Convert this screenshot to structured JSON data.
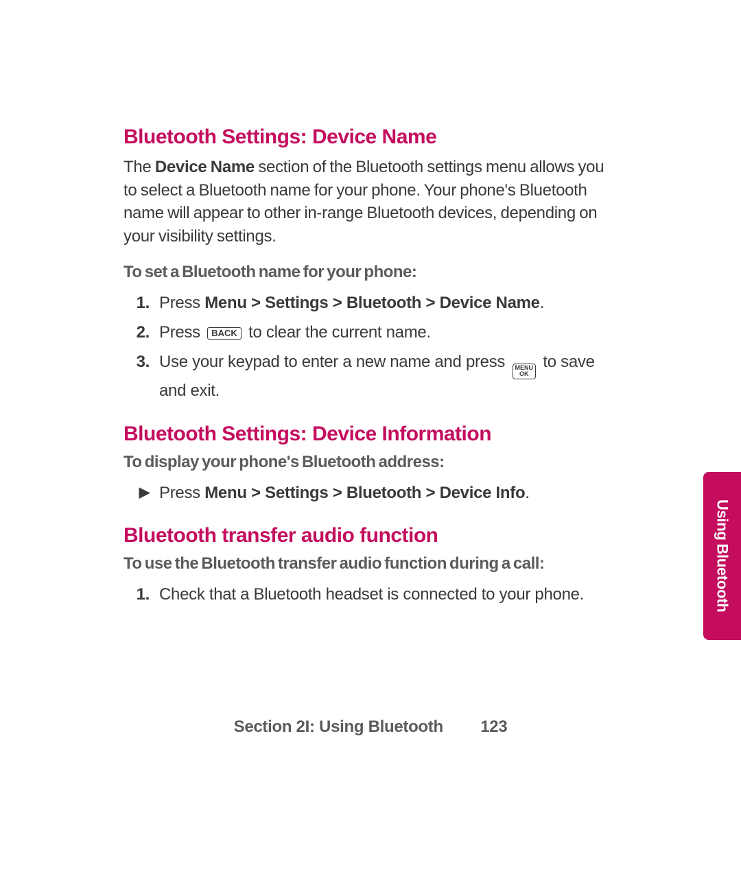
{
  "section1": {
    "heading": "Bluetooth Settings: Device Name",
    "intro_pre": "The ",
    "intro_bold": "Device Name",
    "intro_post": " section of the Bluetooth settings menu allows you to select a Bluetooth name for your phone. Your phone's Bluetooth name will appear to other in-range Bluetooth devices, depending on your visibility settings.",
    "subhead": "To set a Bluetooth name for your phone:",
    "step1_num": "1.",
    "step1_pre": "Press ",
    "step1_bold": "Menu > Settings > Bluetooth > Device Name",
    "step1_post": ".",
    "step2_num": "2.",
    "step2_pre": "Press ",
    "step2_key": "BACK",
    "step2_post": " to clear the current name.",
    "step3_num": "3.",
    "step3_pre": "Use your keypad to enter a new name and press ",
    "step3_key_top": "MENU",
    "step3_key_bot": "OK",
    "step3_post": " to save and exit."
  },
  "section2": {
    "heading": "Bluetooth Settings: Device Information",
    "subhead": "To display your phone's Bluetooth address:",
    "bullet_marker": "▶",
    "bullet_pre": "Press ",
    "bullet_bold": "Menu > Settings > Bluetooth > Device Info",
    "bullet_post": "."
  },
  "section3": {
    "heading": "Bluetooth transfer audio function",
    "subhead": "To use the Bluetooth transfer audio function during a call:",
    "step1_num": "1.",
    "step1_text": "Check that a Bluetooth headset is connected to your phone."
  },
  "sidetab": "Using Bluetooth",
  "footer": {
    "section": "Section 2I: Using Bluetooth",
    "page": "123"
  }
}
